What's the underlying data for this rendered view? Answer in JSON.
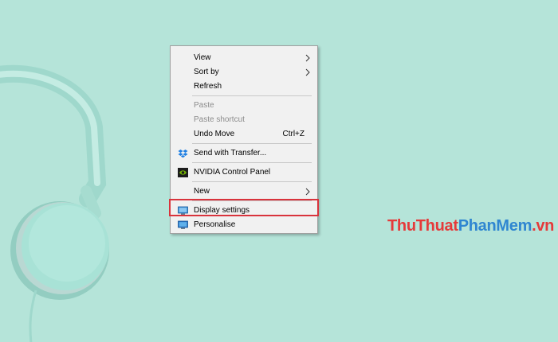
{
  "context_menu": {
    "items": [
      {
        "label": "View",
        "submenu": true,
        "disabled": false
      },
      {
        "label": "Sort by",
        "submenu": true,
        "disabled": false
      },
      {
        "label": "Refresh",
        "disabled": false
      },
      {
        "label": "Paste",
        "disabled": true
      },
      {
        "label": "Paste shortcut",
        "disabled": true
      },
      {
        "label": "Undo Move",
        "shortcut": "Ctrl+Z",
        "disabled": false
      },
      {
        "label": "Send with Transfer...",
        "icon": "dropbox-transfer-icon",
        "disabled": false
      },
      {
        "label": "NVIDIA Control Panel",
        "icon": "nvidia-icon",
        "disabled": false
      },
      {
        "label": "New",
        "submenu": true,
        "disabled": false
      },
      {
        "label": "Display settings",
        "icon": "display-icon",
        "disabled": false,
        "highlighted": true
      },
      {
        "label": "Personalise",
        "icon": "personalise-icon",
        "disabled": false
      }
    ]
  },
  "watermark": {
    "part1": "ThuThuat",
    "part2": "PhanMem",
    "part3": ".vn"
  },
  "colors": {
    "background": "#b5e4d9",
    "highlight_border": "#d9333c",
    "watermark_red": "#e53a3a",
    "watermark_blue": "#2f86d1"
  }
}
